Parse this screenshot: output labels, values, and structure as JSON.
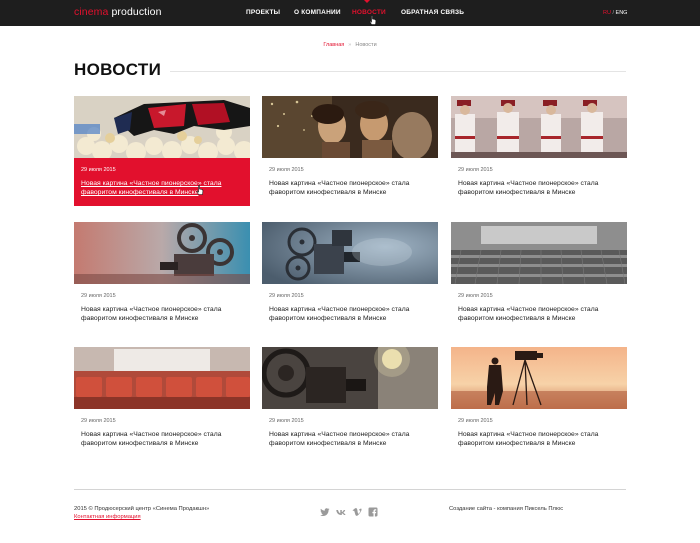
{
  "header": {
    "logo_part1": "cinema",
    "logo_part2": " production",
    "nav": [
      {
        "label": "ПРОЕКТЫ",
        "active": false
      },
      {
        "label": "О КОМПАНИИ",
        "active": false
      },
      {
        "label": "НОВОСТИ",
        "active": true
      },
      {
        "label": "ОБРАТНАЯ СВЯЗЬ",
        "active": false
      }
    ],
    "lang_current": "RU",
    "lang_separator": " / ",
    "lang_other": "ENG"
  },
  "breadcrumb": {
    "home": "Главная",
    "separator": "»",
    "current": "Новости"
  },
  "page": {
    "title": "НОВОСТИ"
  },
  "news": [
    {
      "date": "29 июля 2015",
      "headline": "Новая картина «Частное пионерское» стала фаворитом кинофестиваля в Минске",
      "featured": true,
      "image": "popcorn-3d-glasses"
    },
    {
      "date": "29 июля 2015",
      "headline": "Новая картина «Частное пионерское» стала фаворитом кинофестиваля в Минске",
      "featured": false,
      "image": "cinema-audience"
    },
    {
      "date": "29 июля 2015",
      "headline": "Новая картина «Частное пионерское» стала фаворитом кинофестиваля в Минске",
      "featured": false,
      "image": "folk-dancers"
    },
    {
      "date": "29 июля 2015",
      "headline": "Новая картина «Частное пионерское» стала фаворитом кинофестиваля в Минске",
      "featured": false,
      "image": "film-projector-reels"
    },
    {
      "date": "29 июля 2015",
      "headline": "Новая картина «Частное пионерское» стала фаворитом кинофестиваля в Минске",
      "featured": false,
      "image": "vintage-projector"
    },
    {
      "date": "29 июля 2015",
      "headline": "Новая картина «Частное пионерское» стала фаворитом кинофестиваля в Минске",
      "featured": false,
      "image": "empty-cinema-hall"
    },
    {
      "date": "29 июля 2015",
      "headline": "Новая картина «Частное пионерское» стала фаворитом кинофестиваля в Минске",
      "featured": false,
      "image": "red-cinema-seats"
    },
    {
      "date": "29 июля 2015",
      "headline": "Новая картина «Частное пионерское» стала фаворитом кинофестиваля в Минске",
      "featured": false,
      "image": "projector-light-beam"
    },
    {
      "date": "29 июля 2015",
      "headline": "Новая картина «Частное пионерское» стала фаворитом кинофестиваля в Минске",
      "featured": false,
      "image": "cameraman-sunset"
    }
  ],
  "footer": {
    "copyright": "2015 © Продюсерский центр «Синема Продакшн»",
    "contact_link": "Контактная информация",
    "social": [
      "twitter-icon",
      "vk-icon",
      "vimeo-icon",
      "facebook-icon"
    ],
    "credit": "Создание сайта - компания Пиксель Плюс"
  },
  "colors": {
    "accent": "#e2102d",
    "topbar": "#1e1e1e"
  }
}
